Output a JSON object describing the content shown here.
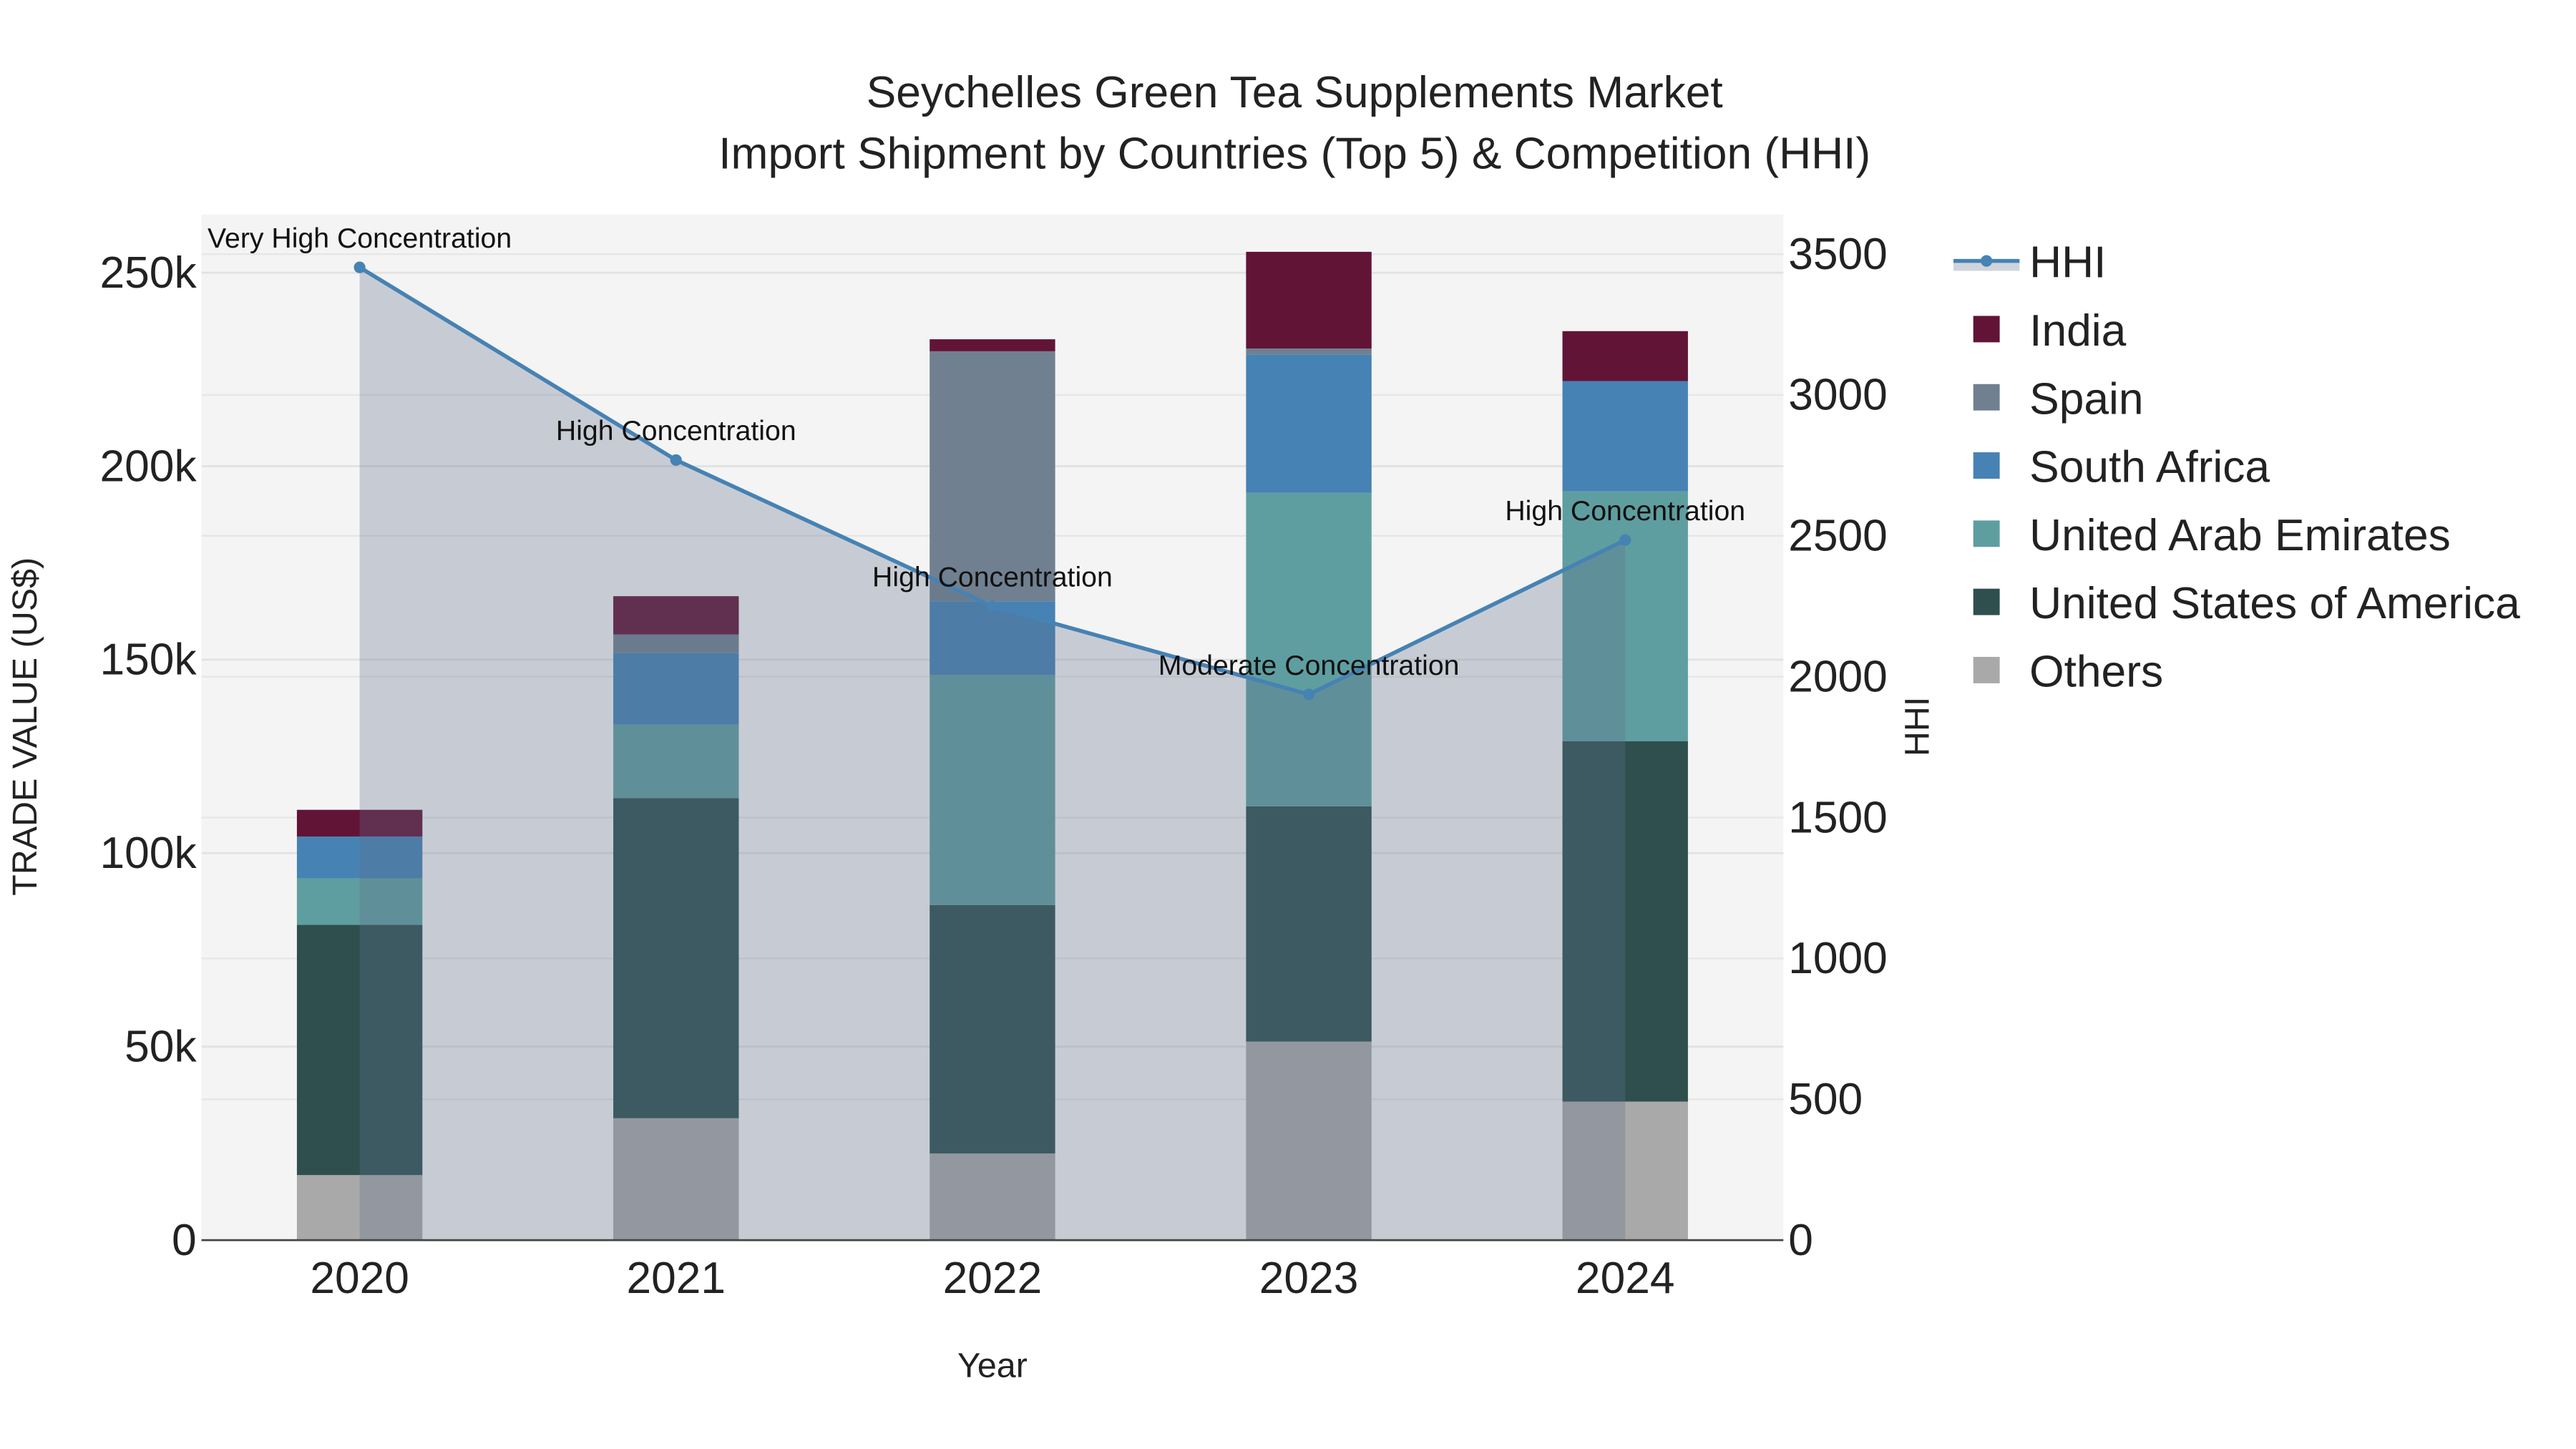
{
  "chart_data": {
    "type": "bar",
    "stacked": true,
    "title": "Seychelles Green Tea Supplements Market",
    "subtitle": "Import Shipment by Countries (Top 5) & Competition (HHI)",
    "xlabel": "Year",
    "ylabel": "TRADE VALUE (US$)",
    "y2label": "HHI",
    "categories": [
      "2020",
      "2021",
      "2022",
      "2023",
      "2024"
    ],
    "ylim": [
      0,
      265000
    ],
    "y_ticks": [
      0,
      50000,
      100000,
      150000,
      200000,
      250000
    ],
    "y_tick_labels": [
      "0",
      "50k",
      "100k",
      "150k",
      "200k",
      "250k"
    ],
    "y2lim": [
      0,
      3640
    ],
    "y2_ticks": [
      0,
      500,
      1000,
      1500,
      2000,
      2500,
      3000,
      3500
    ],
    "y2_tick_labels": [
      "0",
      "500",
      "1000",
      "1500",
      "2000",
      "2500",
      "3000",
      "3500"
    ],
    "grid": true,
    "legend_position": "right",
    "series": [
      {
        "name": "Others",
        "color": "#a9a9a9",
        "values": [
          16800,
          31500,
          22400,
          51300,
          35800
        ]
      },
      {
        "name": "United States of America",
        "color": "#2f4f4f",
        "values": [
          64700,
          82700,
          64200,
          60800,
          93100
        ]
      },
      {
        "name": "United Arab Emirates",
        "color": "#5f9ea0",
        "values": [
          12000,
          19000,
          59500,
          81000,
          64600
        ]
      },
      {
        "name": "South Africa",
        "color": "#4682b4",
        "values": [
          10800,
          18500,
          19000,
          35800,
          28500
        ]
      },
      {
        "name": "Spain",
        "color": "#708090",
        "values": [
          0,
          4800,
          64600,
          1500,
          0
        ]
      },
      {
        "name": "India",
        "color": "#621436",
        "values": [
          6900,
          9900,
          3100,
          25000,
          12900
        ]
      }
    ],
    "hhi": {
      "name": "HHI",
      "color": "#4682b4",
      "values": [
        3453,
        2769,
        2250,
        1937,
        2485
      ],
      "annotations": [
        "Very High Concentration",
        "High Concentration",
        "High Concentration",
        "Moderate Concentration",
        "High Concentration"
      ]
    },
    "legend_order": [
      "HHI",
      "India",
      "Spain",
      "South Africa",
      "United Arab Emirates",
      "United States of America",
      "Others"
    ]
  }
}
